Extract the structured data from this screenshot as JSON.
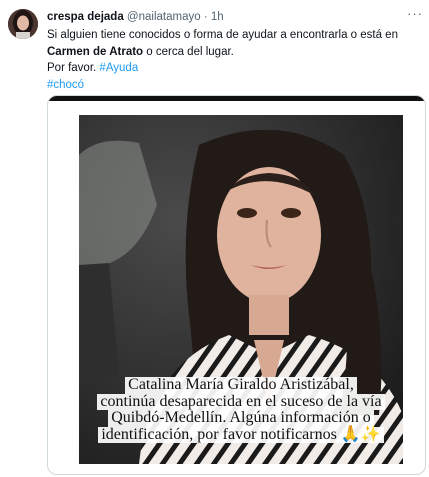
{
  "tweet": {
    "author_name": "crespa dejada",
    "author_handle": "@nailatamayo",
    "separator": "·",
    "time": "1h",
    "more_label": "···",
    "text_line1": "Si alguien tiene conocidos o forma de ayudar a encontrarla o está en",
    "text_bold": "Carmen de Atrato",
    "text_after_bold": " o cerca del lugar.",
    "text_please": "Por favor. ",
    "hashtag_ayuda": "#Ayuda",
    "hashtag_choco": "#chocó"
  },
  "media": {
    "caption_lines": [
      "Catalina María Giraldo Aristizábal,",
      "continúa desaparecida en el suceso de la vía",
      "Quibdó-Medellín. Algúna información o",
      "identificación, por favor notificarnos 🙏✨"
    ]
  },
  "colors": {
    "link": "#1d9bf0",
    "secondary_text": "#536471",
    "border": "#cfd9de"
  }
}
